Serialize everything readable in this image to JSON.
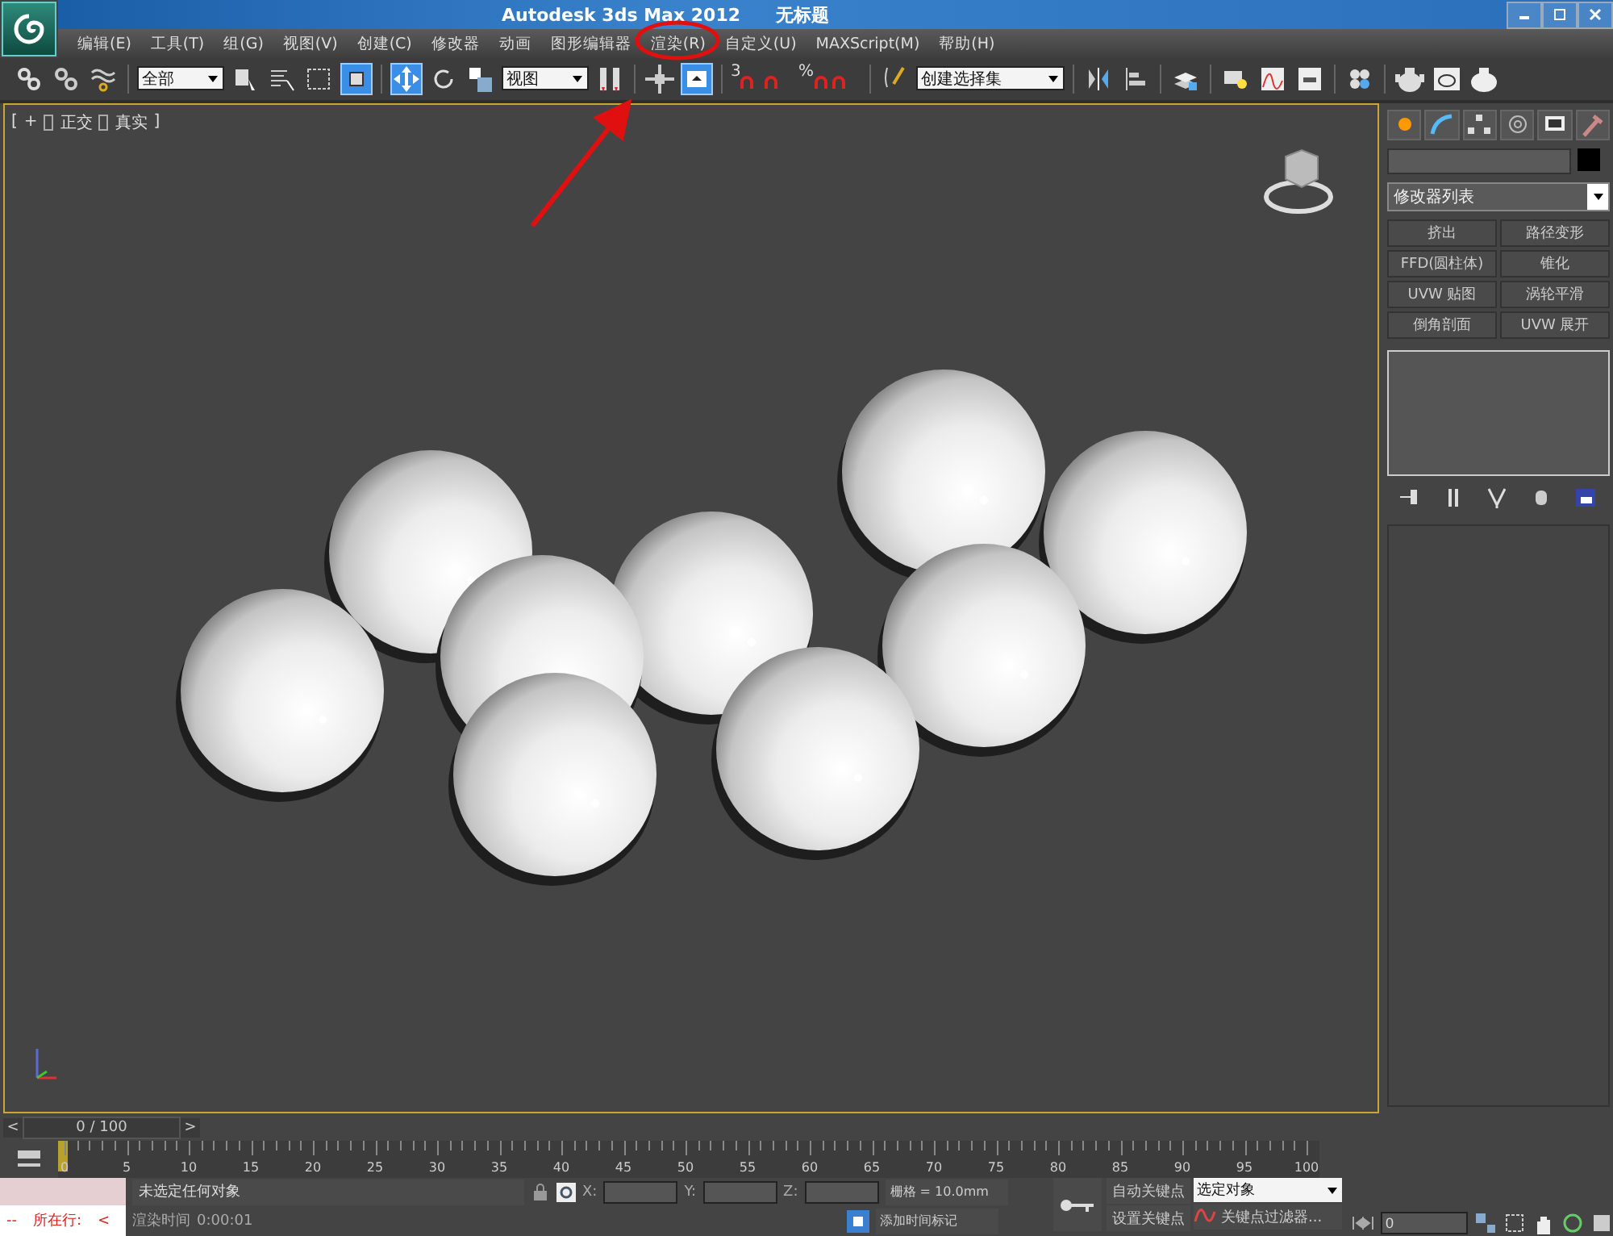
{
  "window": {
    "title": "Autodesk 3ds Max  2012",
    "document": "无标题"
  },
  "menu": [
    "编辑(E)",
    "工具(T)",
    "组(G)",
    "视图(V)",
    "创建(C)",
    "修改器",
    "动画",
    "图形编辑器",
    "渲染(R)",
    "自定义(U)",
    "MAXScript(M)",
    "帮助(H)"
  ],
  "toolbar": [
    {
      "kind": "tool",
      "active": false
    },
    {
      "kind": "tool",
      "active": false
    },
    {
      "kind": "tool",
      "active": false
    },
    {
      "kind": "separator"
    },
    {
      "kind": "dropdown",
      "value": "全部"
    },
    {
      "kind": "tool",
      "active": false
    },
    {
      "kind": "tool",
      "active": false
    },
    {
      "kind": "tool",
      "active": false
    },
    {
      "kind": "tool",
      "active": true
    },
    {
      "kind": "separator"
    },
    {
      "kind": "tool",
      "active": true
    },
    {
      "kind": "tool",
      "active": false
    },
    {
      "kind": "tool",
      "active": false
    },
    {
      "kind": "dropdown",
      "value": "视图"
    },
    {
      "kind": "tool",
      "active": false
    },
    {
      "kind": "separator"
    },
    {
      "kind": "tool",
      "active": false
    },
    {
      "kind": "tool",
      "active": true
    },
    {
      "kind": "separator"
    },
    {
      "kind": "snap",
      "label": "3"
    },
    {
      "kind": "snap"
    },
    {
      "kind": "snap",
      "label": "%"
    },
    {
      "kind": "snap"
    },
    {
      "kind": "separator"
    },
    {
      "kind": "tool",
      "active": false
    },
    {
      "kind": "dropdown",
      "value": "创建选择集"
    },
    {
      "kind": "separator"
    },
    {
      "kind": "tool",
      "active": false
    },
    {
      "kind": "tool",
      "active": false
    },
    {
      "kind": "separator"
    },
    {
      "kind": "tool",
      "active": false
    },
    {
      "kind": "separator"
    },
    {
      "kind": "tool",
      "active": false
    },
    {
      "kind": "tool",
      "active": false
    },
    {
      "kind": "tool",
      "active": false
    },
    {
      "kind": "separator"
    },
    {
      "kind": "tool",
      "active": false
    },
    {
      "kind": "separator"
    },
    {
      "kind": "tool",
      "active": false
    },
    {
      "kind": "tool",
      "active": false
    },
    {
      "kind": "tool",
      "active": false
    }
  ],
  "viewport": {
    "label": {
      "open": "[",
      "items": [
        "+",
        "正交",
        "真实"
      ],
      "close": "]"
    }
  },
  "command_panel": {
    "modifier_list": "修改器列表",
    "modifiers": [
      "挤出",
      "路径变形",
      "FFD(圆柱体)",
      "锥化",
      "UVW 贴图",
      "涡轮平滑",
      "倒角剖面",
      "UVW 展开"
    ]
  },
  "time_slider": {
    "prev": "<",
    "position": "0 / 100",
    "next": ">"
  },
  "ruler": {
    "labels": [
      "0",
      "5",
      "10",
      "15",
      "20",
      "25",
      "30",
      "35",
      "40",
      "45",
      "50",
      "55",
      "60",
      "65",
      "70",
      "75",
      "80",
      "85",
      "90",
      "95",
      "100"
    ]
  },
  "status": {
    "line_label": "--",
    "line_text": "所在行:",
    "line_arrow": "<",
    "prompt": "未选定任何对象",
    "render_time_label": "渲染时间",
    "render_time": "0:00:01",
    "x_label": "X:",
    "y_label": "Y:",
    "z_label": "Z:",
    "grid": "栅格 = 10.0mm",
    "add_time_tag": "添加时间标记",
    "auto_key": "自动关键点",
    "set_key": "设置关键点",
    "key_mode": "选定对象",
    "key_filters": "关键点过滤器...",
    "frame": "0"
  }
}
